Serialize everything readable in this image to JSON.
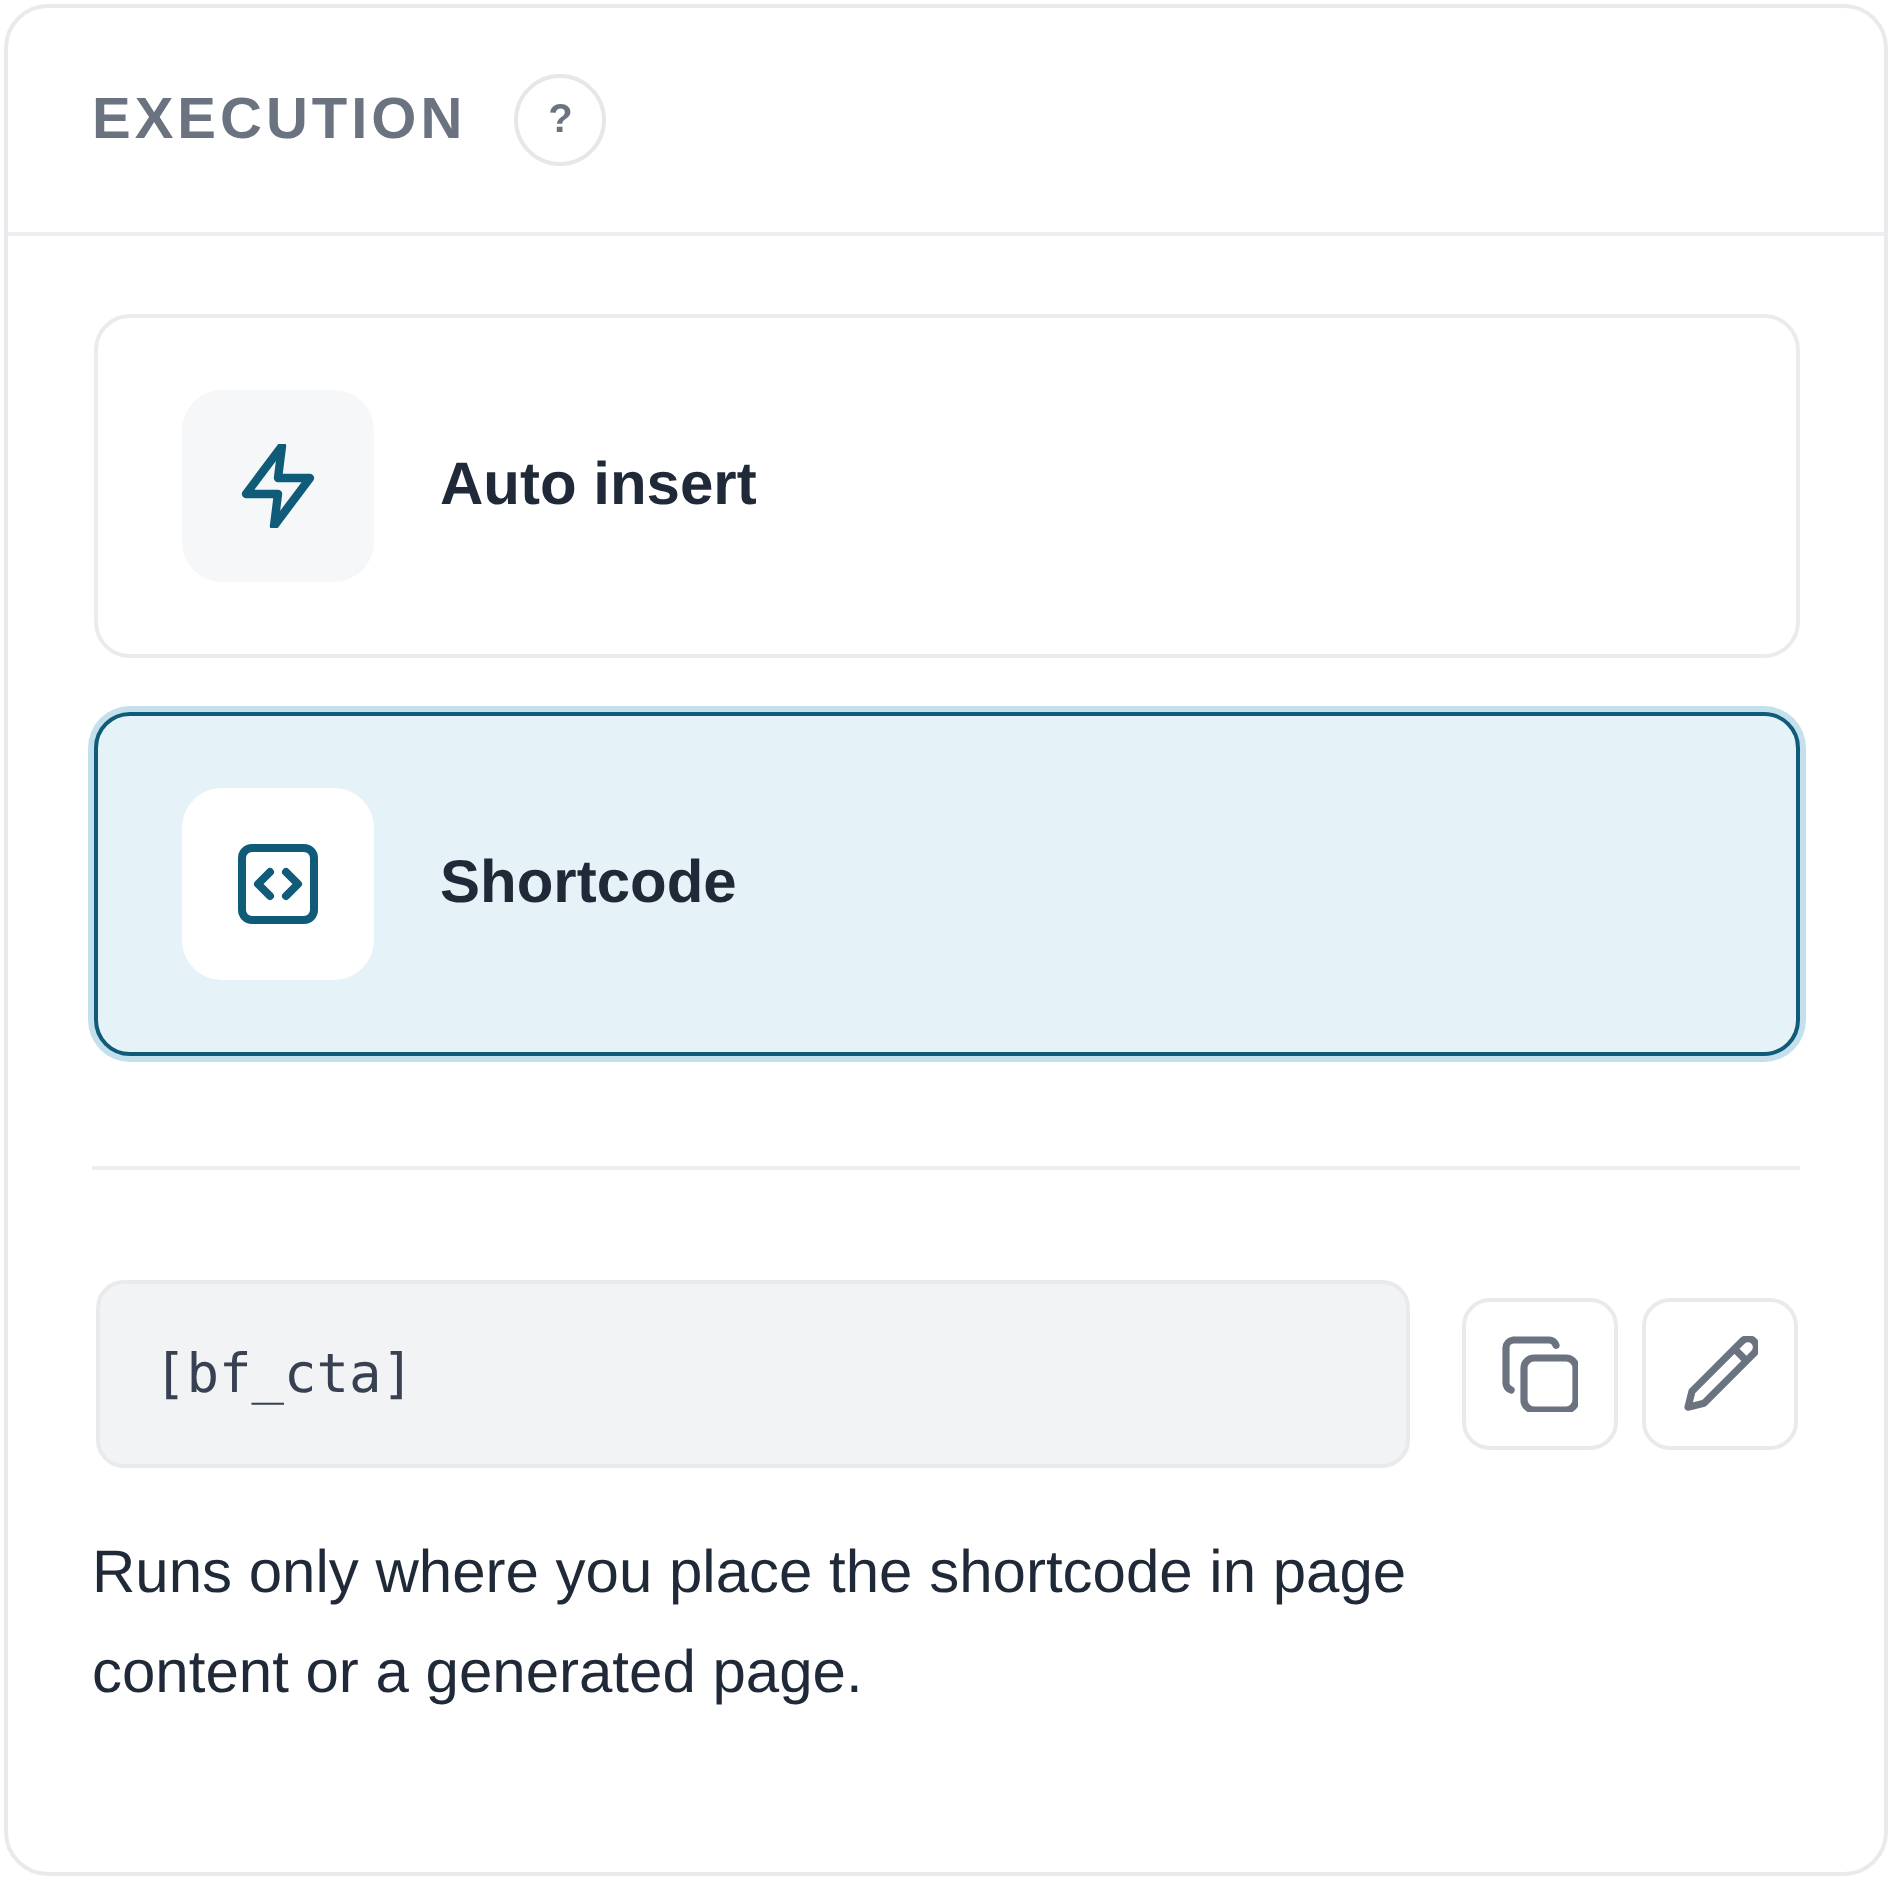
{
  "section": {
    "title": "EXECUTION",
    "help": "?"
  },
  "options": [
    {
      "label": "Auto insert",
      "kind": "bolt",
      "selected": false
    },
    {
      "label": "Shortcode",
      "kind": "code",
      "selected": true
    }
  ],
  "shortcode": {
    "value": "[bf_cta]"
  },
  "actions": [
    {
      "kind": "copy"
    },
    {
      "kind": "edit"
    }
  ],
  "description": "Runs only where you place the shortcode in page content or a generated page."
}
